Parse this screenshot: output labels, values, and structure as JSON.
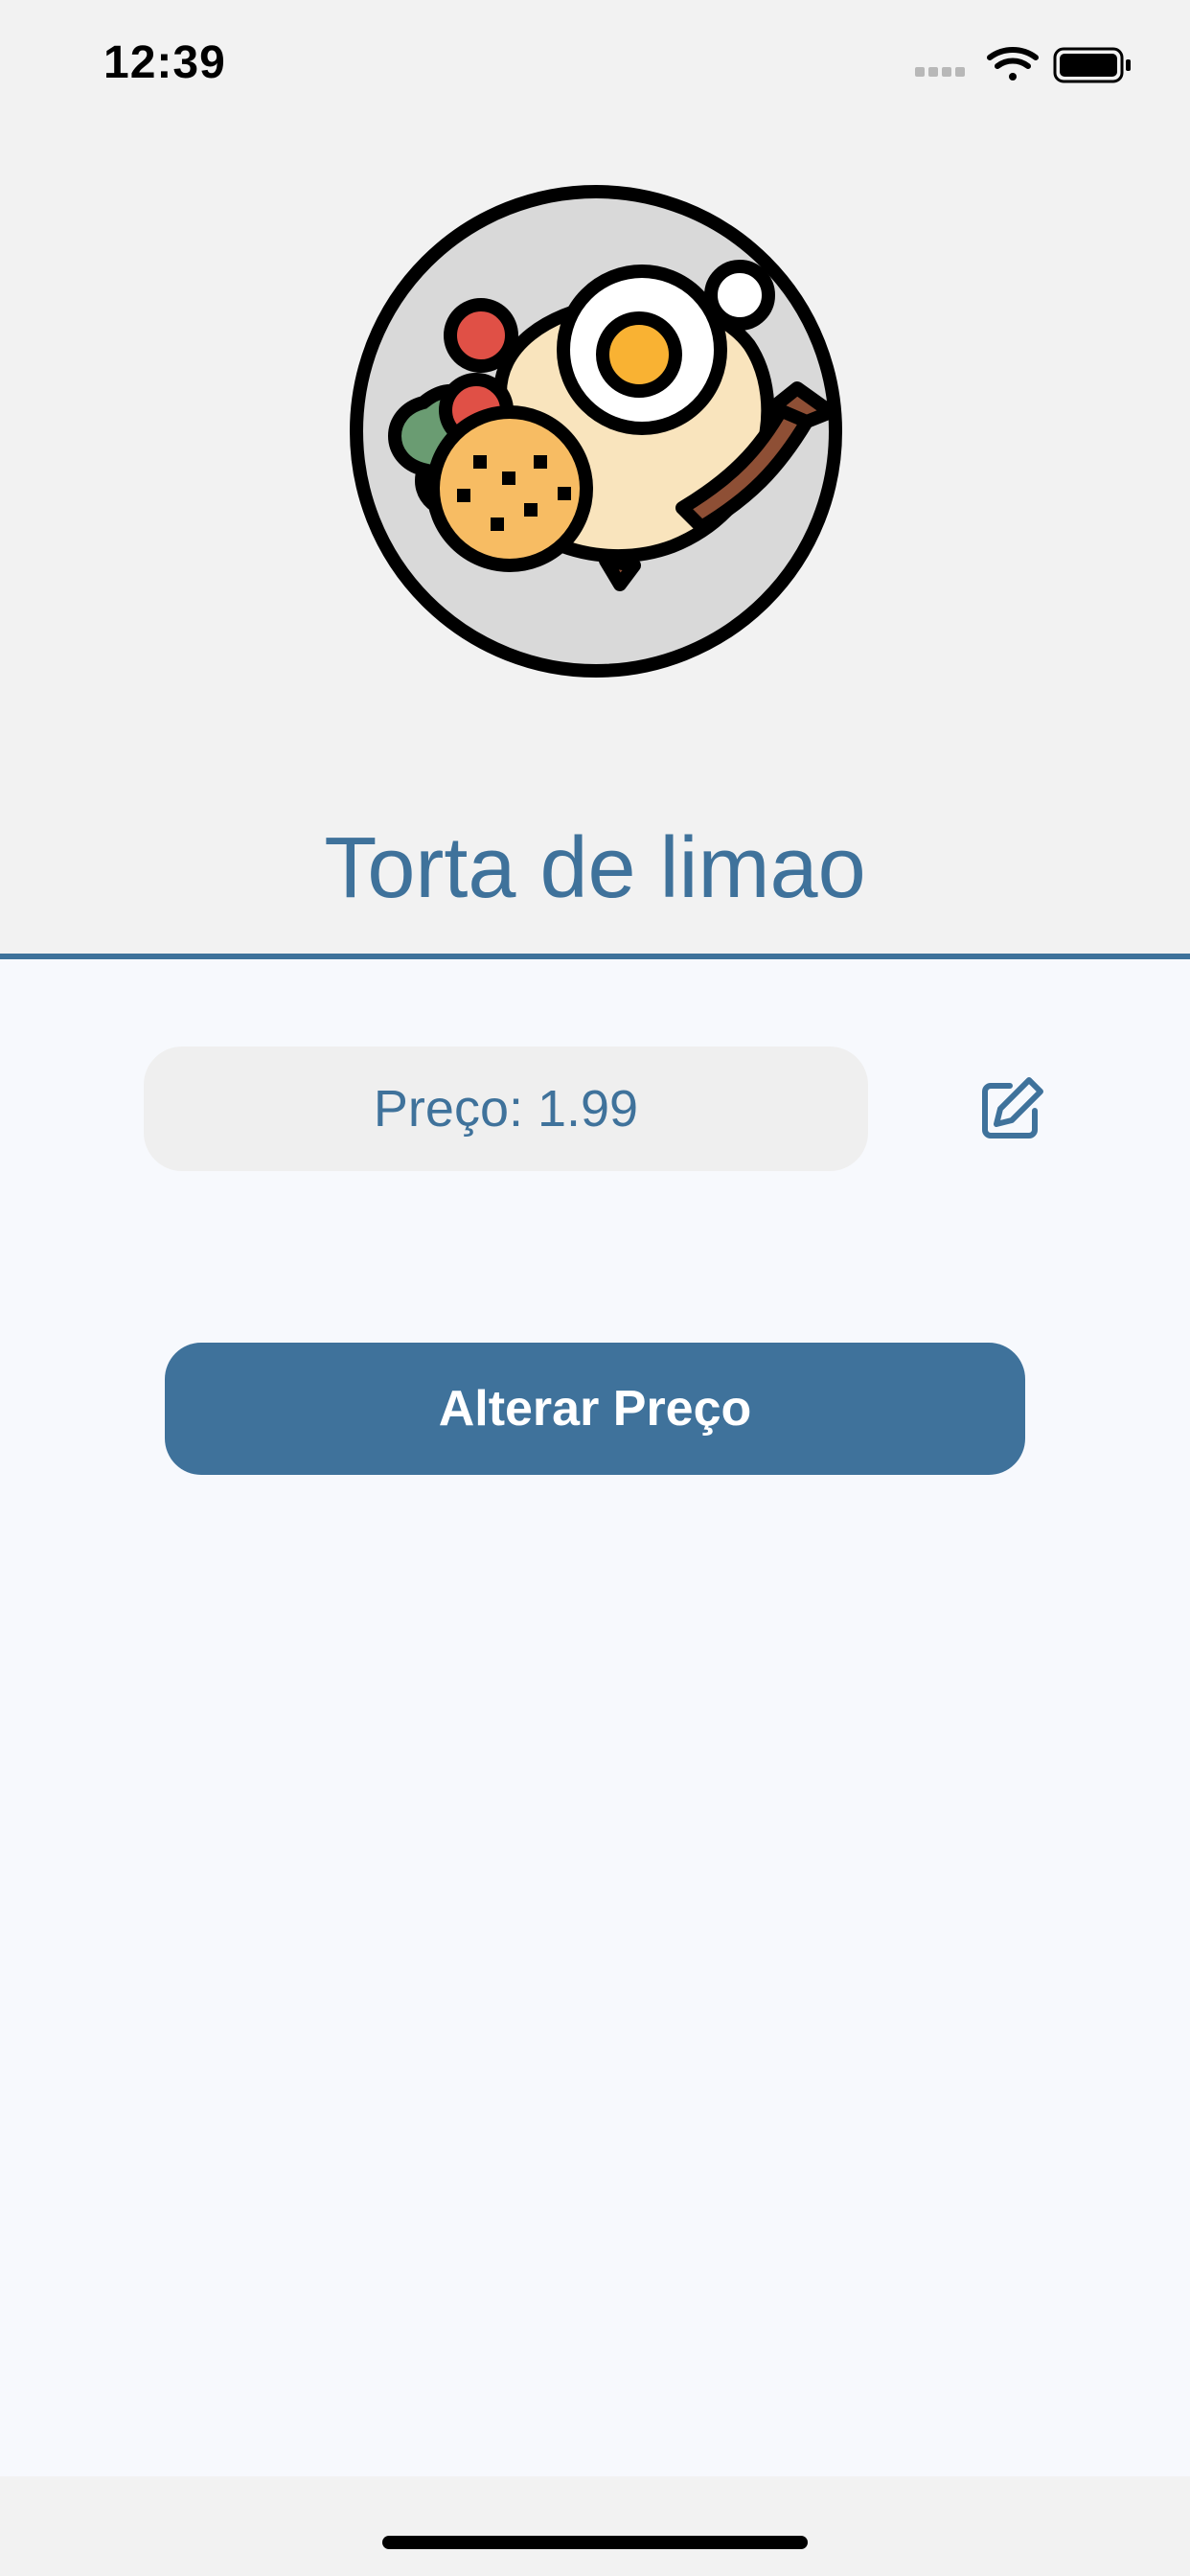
{
  "status_bar": {
    "time": "12:39",
    "signal_icon": "cellular-dots-icon",
    "wifi_icon": "wifi-icon",
    "battery_icon": "battery-icon"
  },
  "header": {
    "image_icon": "plate-of-food-icon",
    "title": "Torta de limao"
  },
  "content": {
    "price_label": "Preço: 1.99",
    "edit_icon": "edit-icon",
    "change_price_button": "Alterar Preço"
  },
  "colors": {
    "accent": "#3f729b",
    "header_bg": "#f2f2f2",
    "content_bg": "#f7f9fd",
    "pill_bg": "#efefef"
  }
}
